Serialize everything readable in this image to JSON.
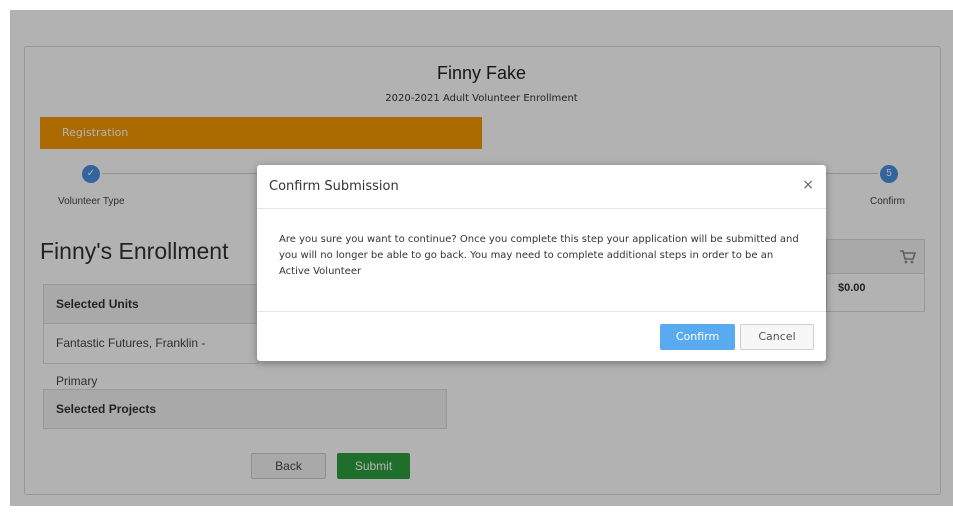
{
  "header": {
    "title": "Finny Fake",
    "subtitle": "2020-2021 Adult Volunteer Enrollment"
  },
  "progress": {
    "label": "Registration",
    "fraction": 0.5
  },
  "steps": {
    "first": {
      "label": "Volunteer Type"
    },
    "last": {
      "number": "5",
      "label": "Confirm"
    }
  },
  "enrollment": {
    "title": "Finny's Enrollment",
    "selected_units": {
      "heading": "Selected Units",
      "item": "Fantastic Futures, Franklin - Primary"
    },
    "selected_projects": {
      "heading": "Selected Projects"
    },
    "total": "$0.00"
  },
  "actions": {
    "back": "Back",
    "submit": "Submit"
  },
  "modal": {
    "title": "Confirm Submission",
    "close": "×",
    "message": "Are you sure you want to continue? Once you complete this step your application will be submitted and you will no longer be able to go back. You may need to complete additional steps in order to be an Active Volunteer",
    "confirm": "Confirm",
    "cancel": "Cancel"
  },
  "colors": {
    "progress": "#f59a00",
    "step": "#4a90e2",
    "confirm": "#5aaaf0",
    "submit": "#2e9e3e"
  }
}
